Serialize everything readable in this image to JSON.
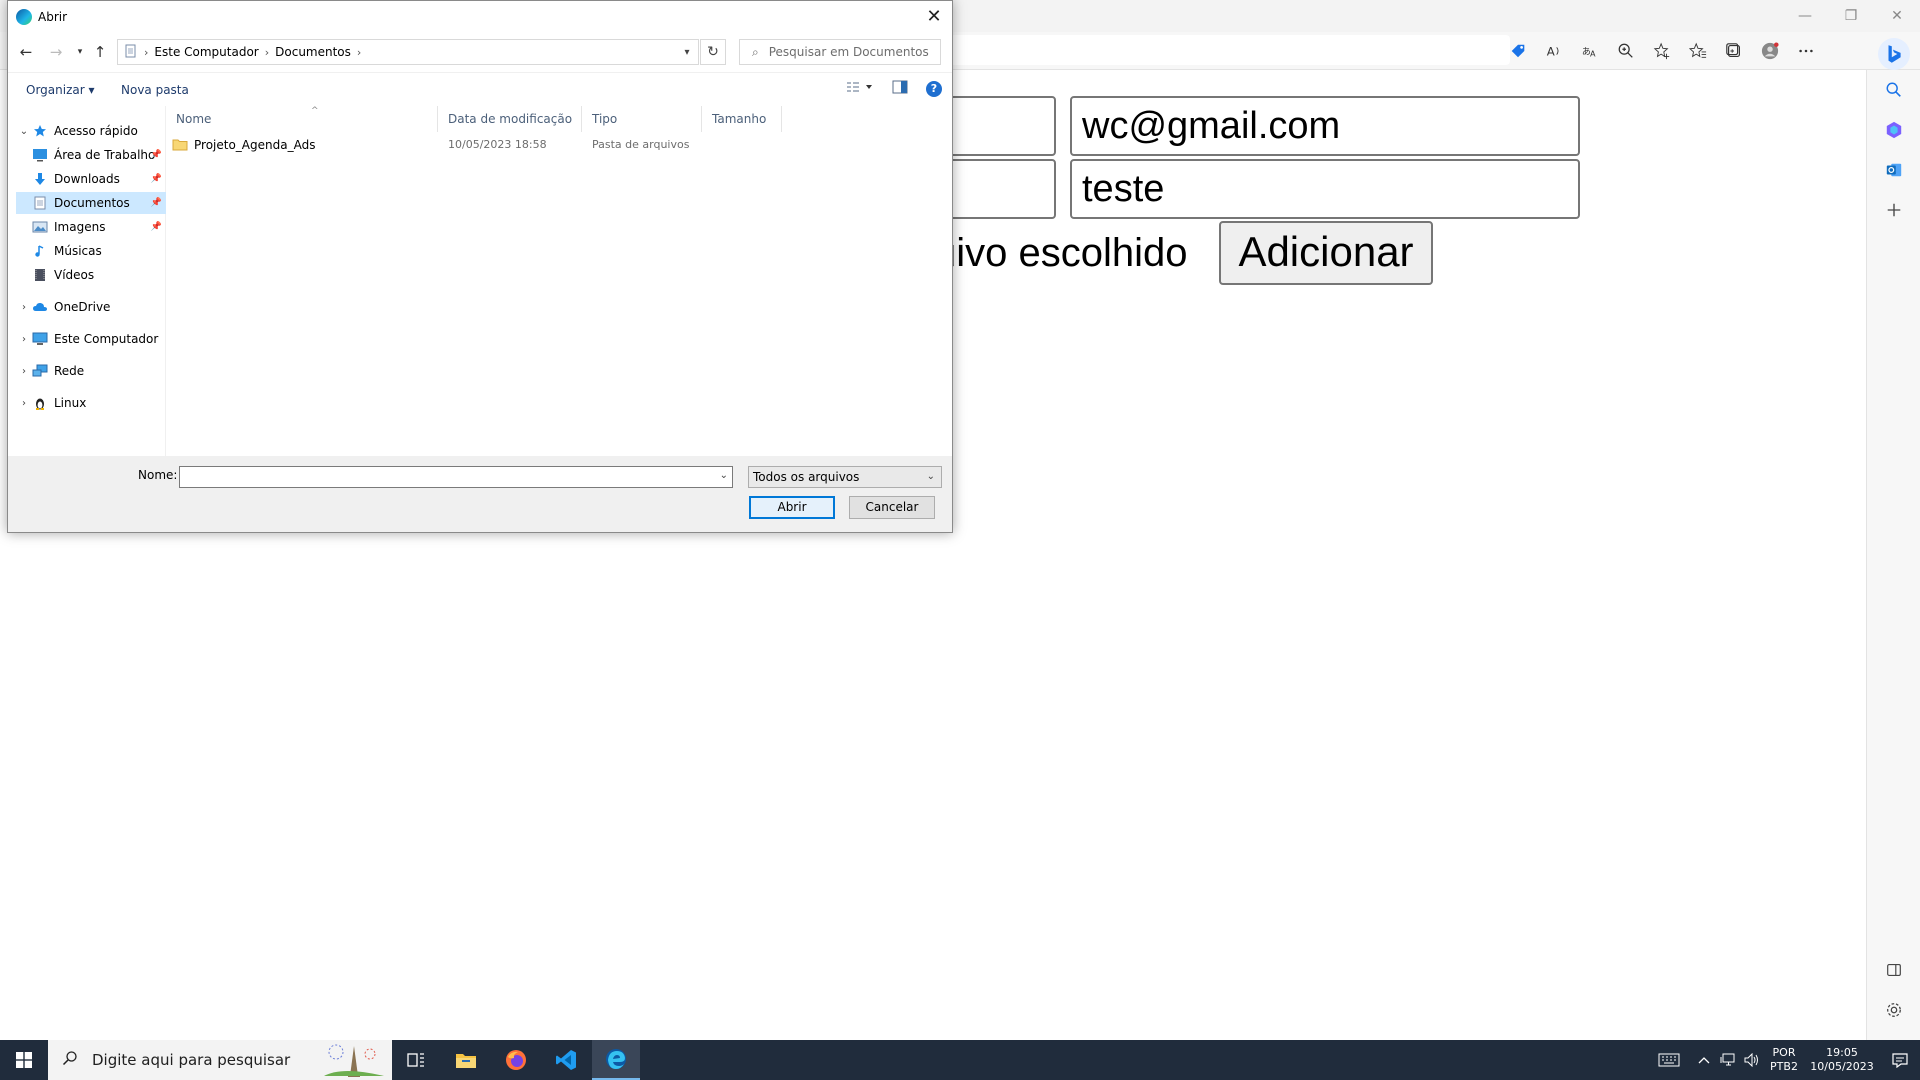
{
  "browser": {
    "window_controls": {
      "minimize": "—",
      "restore": "❐",
      "close": "✕"
    },
    "toolbar_icons": [
      "shopping-tag-icon",
      "read-aloud-icon",
      "translate-icon",
      "zoom-icon",
      "add-favorite-icon",
      "favorites-icon",
      "collections-icon",
      "profile-icon",
      "more-icon"
    ],
    "sidebar_icons": [
      "search-icon",
      "office-icon",
      "outlook-icon",
      "add-icon"
    ],
    "accent_color": "#0078d7"
  },
  "page": {
    "email_value": "wc@gmail.com",
    "password_value": "teste",
    "file_status": "uivo escolhido",
    "add_button": "Adicionar"
  },
  "dialog": {
    "title": "Abrir",
    "breadcrumb": [
      "Este Computador",
      "Documentos"
    ],
    "search_placeholder": "Pesquisar em Documentos",
    "organize": "Organizar",
    "new_folder": "Nova pasta",
    "nav": {
      "quick_access": "Acesso rápido",
      "desktop": "Área de Trabalho",
      "downloads": "Downloads",
      "documents": "Documentos",
      "images": "Imagens",
      "music": "Músicas",
      "videos": "Vídeos",
      "onedrive": "OneDrive",
      "this_pc": "Este Computador",
      "network": "Rede",
      "linux": "Linux"
    },
    "columns": {
      "name": "Nome",
      "date": "Data de modificação",
      "type": "Tipo",
      "size": "Tamanho"
    },
    "files": [
      {
        "name": "Projeto_Agenda_Ads",
        "date": "10/05/2023 18:58",
        "type": "Pasta de arquivos",
        "size": ""
      }
    ],
    "footer": {
      "name_label": "Nome:",
      "name_value": "",
      "filter": "Todos os arquivos",
      "open_button": "Abrir",
      "cancel_button": "Cancelar"
    }
  },
  "taskbar": {
    "search_placeholder": "Digite aqui para pesquisar",
    "lang": "POR",
    "layout": "PTB2",
    "time": "19:05",
    "date": "10/05/2023"
  }
}
